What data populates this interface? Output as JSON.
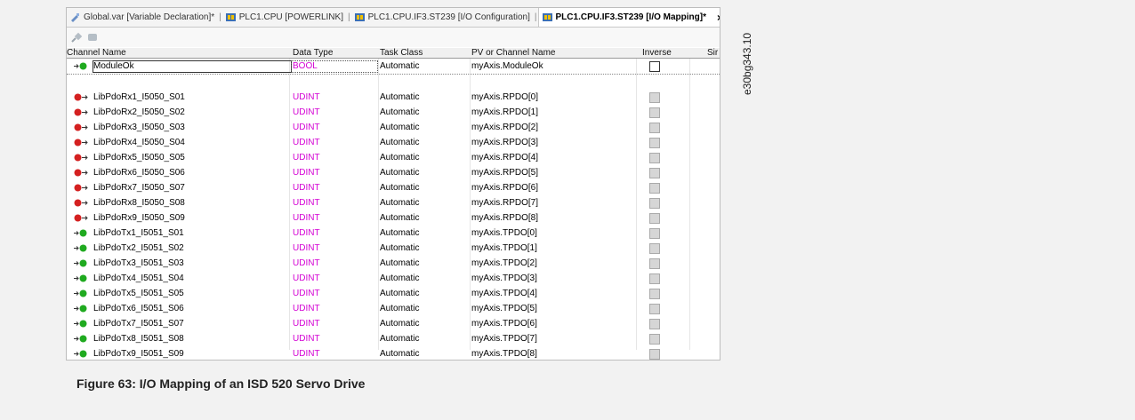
{
  "tabs": [
    {
      "label": "Global.var [Variable Declaration]*",
      "icon": "variable-declaration-icon",
      "active": false
    },
    {
      "label": "PLC1.CPU [POWERLINK]",
      "icon": "module-icon",
      "active": false
    },
    {
      "label": "PLC1.CPU.IF3.ST239 [I/O Configuration]",
      "icon": "module-icon",
      "active": false
    },
    {
      "label": "PLC1.CPU.IF3.ST239 [I/O Mapping]*",
      "icon": "module-icon",
      "active": true
    }
  ],
  "tab_close": "×",
  "toolbar": {
    "icons": [
      "connect-icon",
      "disconnect-icon"
    ]
  },
  "table": {
    "headers": {
      "channel_name": "Channel Name",
      "data_type": "Data Type",
      "task_class": "Task Class",
      "pv": "PV or Channel Name",
      "inverse": "Inverse",
      "more": "Sir"
    },
    "rows": [
      {
        "dir": "in",
        "name": "ModuleOk",
        "type": "BOOL",
        "task": "Automatic",
        "pv": "myAxis.ModuleOk",
        "inverse_enabled": true
      },
      {
        "dir": "out",
        "name": "LibPdoRx1_I5050_S01",
        "type": "UDINT",
        "task": "Automatic",
        "pv": "myAxis.RPDO[0]",
        "inverse_enabled": false
      },
      {
        "dir": "out",
        "name": "LibPdoRx2_I5050_S02",
        "type": "UDINT",
        "task": "Automatic",
        "pv": "myAxis.RPDO[1]",
        "inverse_enabled": false
      },
      {
        "dir": "out",
        "name": "LibPdoRx3_I5050_S03",
        "type": "UDINT",
        "task": "Automatic",
        "pv": "myAxis.RPDO[2]",
        "inverse_enabled": false
      },
      {
        "dir": "out",
        "name": "LibPdoRx4_I5050_S04",
        "type": "UDINT",
        "task": "Automatic",
        "pv": "myAxis.RPDO[3]",
        "inverse_enabled": false
      },
      {
        "dir": "out",
        "name": "LibPdoRx5_I5050_S05",
        "type": "UDINT",
        "task": "Automatic",
        "pv": "myAxis.RPDO[4]",
        "inverse_enabled": false
      },
      {
        "dir": "out",
        "name": "LibPdoRx6_I5050_S06",
        "type": "UDINT",
        "task": "Automatic",
        "pv": "myAxis.RPDO[5]",
        "inverse_enabled": false
      },
      {
        "dir": "out",
        "name": "LibPdoRx7_I5050_S07",
        "type": "UDINT",
        "task": "Automatic",
        "pv": "myAxis.RPDO[6]",
        "inverse_enabled": false
      },
      {
        "dir": "out",
        "name": "LibPdoRx8_I5050_S08",
        "type": "UDINT",
        "task": "Automatic",
        "pv": "myAxis.RPDO[7]",
        "inverse_enabled": false
      },
      {
        "dir": "out",
        "name": "LibPdoRx9_I5050_S09",
        "type": "UDINT",
        "task": "Automatic",
        "pv": "myAxis.RPDO[8]",
        "inverse_enabled": false
      },
      {
        "dir": "in",
        "name": "LibPdoTx1_I5051_S01",
        "type": "UDINT",
        "task": "Automatic",
        "pv": "myAxis.TPDO[0]",
        "inverse_enabled": false
      },
      {
        "dir": "in",
        "name": "LibPdoTx2_I5051_S02",
        "type": "UDINT",
        "task": "Automatic",
        "pv": "myAxis.TPDO[1]",
        "inverse_enabled": false
      },
      {
        "dir": "in",
        "name": "LibPdoTx3_I5051_S03",
        "type": "UDINT",
        "task": "Automatic",
        "pv": "myAxis.TPDO[2]",
        "inverse_enabled": false
      },
      {
        "dir": "in",
        "name": "LibPdoTx4_I5051_S04",
        "type": "UDINT",
        "task": "Automatic",
        "pv": "myAxis.TPDO[3]",
        "inverse_enabled": false
      },
      {
        "dir": "in",
        "name": "LibPdoTx5_I5051_S05",
        "type": "UDINT",
        "task": "Automatic",
        "pv": "myAxis.TPDO[4]",
        "inverse_enabled": false
      },
      {
        "dir": "in",
        "name": "LibPdoTx6_I5051_S06",
        "type": "UDINT",
        "task": "Automatic",
        "pv": "myAxis.TPDO[5]",
        "inverse_enabled": false
      },
      {
        "dir": "in",
        "name": "LibPdoTx7_I5051_S07",
        "type": "UDINT",
        "task": "Automatic",
        "pv": "myAxis.TPDO[6]",
        "inverse_enabled": false
      },
      {
        "dir": "in",
        "name": "LibPdoTx8_I5051_S08",
        "type": "UDINT",
        "task": "Automatic",
        "pv": "myAxis.TPDO[7]",
        "inverse_enabled": false
      },
      {
        "dir": "in",
        "name": "LibPdoTx9_I5051_S09",
        "type": "UDINT",
        "task": "Automatic",
        "pv": "myAxis.TPDO[8]",
        "inverse_enabled": false
      }
    ]
  },
  "colors": {
    "input_pin": "#1faa1f",
    "output_pin": "#d42020",
    "library_type": "#d400d4",
    "bool_type": "#d400d4"
  },
  "caption": "Figure 63:  I/O Mapping of an ISD 520 Servo Drive",
  "side_id": "e30bg343.10"
}
